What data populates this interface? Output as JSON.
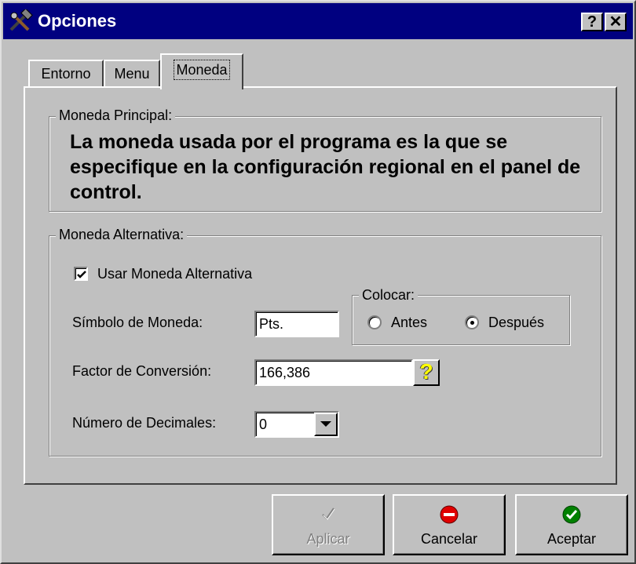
{
  "window": {
    "title": "Opciones",
    "help_glyph": "?",
    "close_glyph": "✕"
  },
  "tabs": [
    {
      "label": "Entorno",
      "selected": false
    },
    {
      "label": "Menu",
      "selected": false
    },
    {
      "label": "Moneda",
      "selected": true
    }
  ],
  "principal": {
    "group_label": "Moneda Principal:",
    "text": "La moneda usada por el programa es la que se especifique en la configuración regional en el panel de control."
  },
  "alternativa": {
    "group_label": "Moneda Alternativa:",
    "use_checkbox_label": "Usar Moneda Alternativa",
    "use_checked": true,
    "symbol_label": "Símbolo de Moneda:",
    "symbol_value": "Pts.",
    "colocar": {
      "group_label": "Colocar:",
      "before_label": "Antes",
      "after_label": "Después",
      "selected": "after"
    },
    "factor_label": "Factor de Conversión:",
    "factor_value": "166,386",
    "factor_help_glyph": "?",
    "decimals_label": "Número de Decimales:",
    "decimals_value": "0"
  },
  "buttons": {
    "apply_label": "Aplicar",
    "apply_enabled": false,
    "cancel_label": "Cancelar",
    "accept_label": "Aceptar"
  },
  "colors": {
    "titlebar": "#000080",
    "face": "#c0c0c0",
    "cancel_icon": "#e00000",
    "accept_icon": "#008000"
  }
}
